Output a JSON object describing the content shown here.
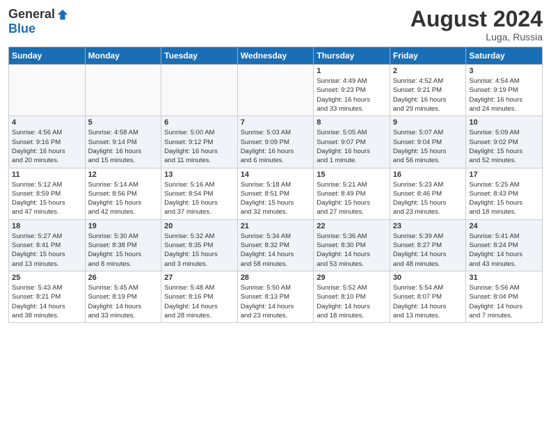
{
  "header": {
    "logo_general": "General",
    "logo_blue": "Blue",
    "month_title": "August 2024",
    "location": "Luga, Russia"
  },
  "weekdays": [
    "Sunday",
    "Monday",
    "Tuesday",
    "Wednesday",
    "Thursday",
    "Friday",
    "Saturday"
  ],
  "weeks": [
    [
      {
        "day": "",
        "info": ""
      },
      {
        "day": "",
        "info": ""
      },
      {
        "day": "",
        "info": ""
      },
      {
        "day": "",
        "info": ""
      },
      {
        "day": "1",
        "info": "Sunrise: 4:49 AM\nSunset: 9:23 PM\nDaylight: 16 hours\nand 33 minutes."
      },
      {
        "day": "2",
        "info": "Sunrise: 4:52 AM\nSunset: 9:21 PM\nDaylight: 16 hours\nand 29 minutes."
      },
      {
        "day": "3",
        "info": "Sunrise: 4:54 AM\nSunset: 9:19 PM\nDaylight: 16 hours\nand 24 minutes."
      }
    ],
    [
      {
        "day": "4",
        "info": "Sunrise: 4:56 AM\nSunset: 9:16 PM\nDaylight: 16 hours\nand 20 minutes."
      },
      {
        "day": "5",
        "info": "Sunrise: 4:58 AM\nSunset: 9:14 PM\nDaylight: 16 hours\nand 15 minutes."
      },
      {
        "day": "6",
        "info": "Sunrise: 5:00 AM\nSunset: 9:12 PM\nDaylight: 16 hours\nand 11 minutes."
      },
      {
        "day": "7",
        "info": "Sunrise: 5:03 AM\nSunset: 9:09 PM\nDaylight: 16 hours\nand 6 minutes."
      },
      {
        "day": "8",
        "info": "Sunrise: 5:05 AM\nSunset: 9:07 PM\nDaylight: 16 hours\nand 1 minute."
      },
      {
        "day": "9",
        "info": "Sunrise: 5:07 AM\nSunset: 9:04 PM\nDaylight: 15 hours\nand 56 minutes."
      },
      {
        "day": "10",
        "info": "Sunrise: 5:09 AM\nSunset: 9:02 PM\nDaylight: 15 hours\nand 52 minutes."
      }
    ],
    [
      {
        "day": "11",
        "info": "Sunrise: 5:12 AM\nSunset: 8:59 PM\nDaylight: 15 hours\nand 47 minutes."
      },
      {
        "day": "12",
        "info": "Sunrise: 5:14 AM\nSunset: 8:56 PM\nDaylight: 15 hours\nand 42 minutes."
      },
      {
        "day": "13",
        "info": "Sunrise: 5:16 AM\nSunset: 8:54 PM\nDaylight: 15 hours\nand 37 minutes."
      },
      {
        "day": "14",
        "info": "Sunrise: 5:18 AM\nSunset: 8:51 PM\nDaylight: 15 hours\nand 32 minutes."
      },
      {
        "day": "15",
        "info": "Sunrise: 5:21 AM\nSunset: 8:49 PM\nDaylight: 15 hours\nand 27 minutes."
      },
      {
        "day": "16",
        "info": "Sunrise: 5:23 AM\nSunset: 8:46 PM\nDaylight: 15 hours\nand 23 minutes."
      },
      {
        "day": "17",
        "info": "Sunrise: 5:25 AM\nSunset: 8:43 PM\nDaylight: 15 hours\nand 18 minutes."
      }
    ],
    [
      {
        "day": "18",
        "info": "Sunrise: 5:27 AM\nSunset: 8:41 PM\nDaylight: 15 hours\nand 13 minutes."
      },
      {
        "day": "19",
        "info": "Sunrise: 5:30 AM\nSunset: 8:38 PM\nDaylight: 15 hours\nand 8 minutes."
      },
      {
        "day": "20",
        "info": "Sunrise: 5:32 AM\nSunset: 8:35 PM\nDaylight: 15 hours\nand 3 minutes."
      },
      {
        "day": "21",
        "info": "Sunrise: 5:34 AM\nSunset: 8:32 PM\nDaylight: 14 hours\nand 58 minutes."
      },
      {
        "day": "22",
        "info": "Sunrise: 5:36 AM\nSunset: 8:30 PM\nDaylight: 14 hours\nand 53 minutes."
      },
      {
        "day": "23",
        "info": "Sunrise: 5:39 AM\nSunset: 8:27 PM\nDaylight: 14 hours\nand 48 minutes."
      },
      {
        "day": "24",
        "info": "Sunrise: 5:41 AM\nSunset: 8:24 PM\nDaylight: 14 hours\nand 43 minutes."
      }
    ],
    [
      {
        "day": "25",
        "info": "Sunrise: 5:43 AM\nSunset: 8:21 PM\nDaylight: 14 hours\nand 38 minutes."
      },
      {
        "day": "26",
        "info": "Sunrise: 5:45 AM\nSunset: 8:19 PM\nDaylight: 14 hours\nand 33 minutes."
      },
      {
        "day": "27",
        "info": "Sunrise: 5:48 AM\nSunset: 8:16 PM\nDaylight: 14 hours\nand 28 minutes."
      },
      {
        "day": "28",
        "info": "Sunrise: 5:50 AM\nSunset: 8:13 PM\nDaylight: 14 hours\nand 23 minutes."
      },
      {
        "day": "29",
        "info": "Sunrise: 5:52 AM\nSunset: 8:10 PM\nDaylight: 14 hours\nand 18 minutes."
      },
      {
        "day": "30",
        "info": "Sunrise: 5:54 AM\nSunset: 8:07 PM\nDaylight: 14 hours\nand 13 minutes."
      },
      {
        "day": "31",
        "info": "Sunrise: 5:56 AM\nSunset: 8:04 PM\nDaylight: 14 hours\nand 7 minutes."
      }
    ]
  ]
}
